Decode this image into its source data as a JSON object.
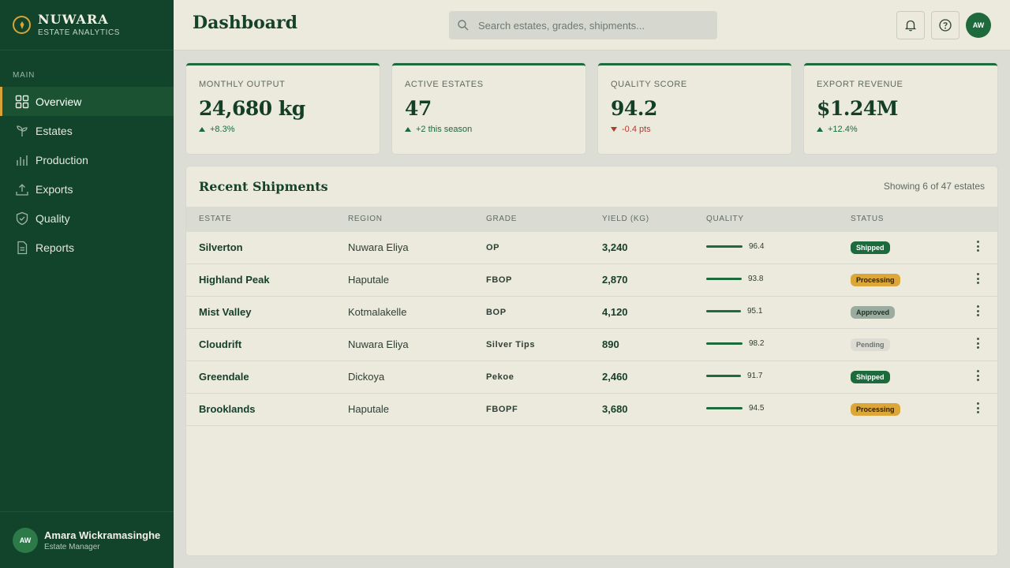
{
  "brand": {
    "name": "NUWARA",
    "subtitle": "ESTATE ANALYTICS"
  },
  "sidebar": {
    "section_label": "MAIN",
    "items": [
      {
        "label": "Overview",
        "icon": "grid-icon",
        "active": true
      },
      {
        "label": "Estates",
        "icon": "sprout-icon"
      },
      {
        "label": "Production",
        "icon": "bar-chart-icon"
      },
      {
        "label": "Exports",
        "icon": "upload-icon"
      },
      {
        "label": "Quality",
        "icon": "shield-check-icon"
      },
      {
        "label": "Reports",
        "icon": "document-icon"
      }
    ],
    "user": {
      "initials": "AW",
      "name": "Amara Wickramasinghe",
      "role": "Estate Manager"
    }
  },
  "header": {
    "title": "Dashboard",
    "search_placeholder": "Search estates, grades, shipments...",
    "avatar_initials": "AW"
  },
  "stats": [
    {
      "label": "MONTHLY OUTPUT",
      "value": "24,680 kg",
      "delta": "+8.3%",
      "direction": "up"
    },
    {
      "label": "ACTIVE ESTATES",
      "value": "47",
      "delta": "+2 this season",
      "direction": "up"
    },
    {
      "label": "QUALITY SCORE",
      "value": "94.2",
      "delta": "-0.4 pts",
      "direction": "down"
    },
    {
      "label": "EXPORT REVENUE",
      "value": "$1.24M",
      "delta": "+12.4%",
      "direction": "up"
    }
  ],
  "shipments": {
    "title": "Recent Shipments",
    "meta": "Showing 6 of 47 estates",
    "columns": [
      "ESTATE",
      "REGION",
      "GRADE",
      "YIELD (KG)",
      "QUALITY",
      "STATUS"
    ],
    "rows": [
      {
        "estate": "Silverton",
        "region": "Nuwara Eliya",
        "grade": "OP",
        "yield": "3,240",
        "quality": "96.4",
        "quality_level": 0.46,
        "status": "Shipped"
      },
      {
        "estate": "Highland Peak",
        "region": "Haputale",
        "grade": "FBOP",
        "yield": "2,870",
        "quality": "93.8",
        "quality_level": 0.45,
        "status": "Processing"
      },
      {
        "estate": "Mist Valley",
        "region": "Kotmalakelle",
        "grade": "BOP",
        "yield": "4,120",
        "quality": "95.1",
        "quality_level": 0.44,
        "status": "Approved"
      },
      {
        "estate": "Cloudrift",
        "region": "Nuwara Eliya",
        "grade": "Silver Tips",
        "yield": "890",
        "quality": "98.2",
        "quality_level": 0.46,
        "status": "Pending"
      },
      {
        "estate": "Greendale",
        "region": "Dickoya",
        "grade": "Pekoe",
        "yield": "2,460",
        "quality": "91.7",
        "quality_level": 0.44,
        "status": "Shipped"
      },
      {
        "estate": "Brooklands",
        "region": "Haputale",
        "grade": "FBOPF",
        "yield": "3,680",
        "quality": "94.5",
        "quality_level": 0.46,
        "status": "Processing"
      }
    ]
  },
  "colors": {
    "sidebar": "#11442a",
    "accent": "#d9a437",
    "primary": "#1d6a3c",
    "negative": "#b03a2e"
  }
}
